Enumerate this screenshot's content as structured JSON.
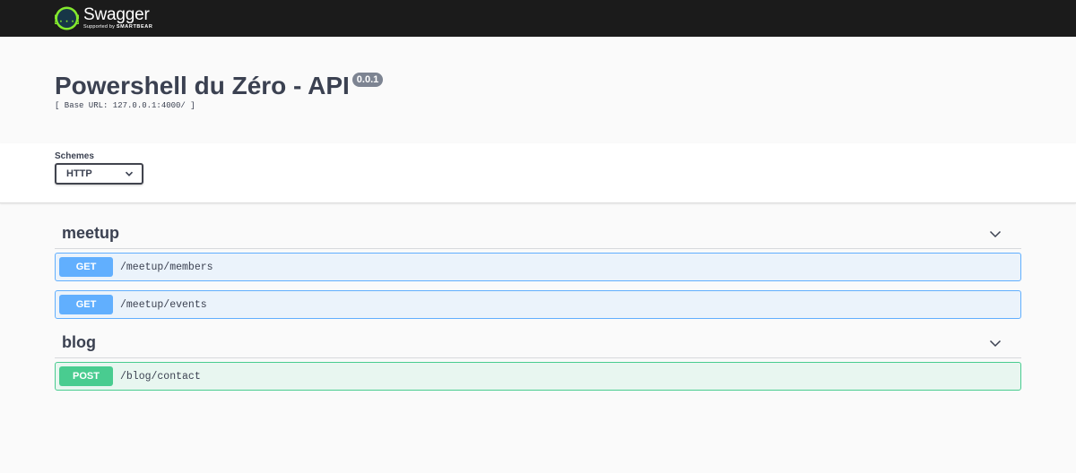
{
  "topbar": {
    "logo_name": "Swagger",
    "logo_tag_prefix": "Supported by",
    "logo_tag_brand": "SMARTBEAR",
    "logo_icon": "swagger-logo-icon",
    "colors": {
      "background": "#1b1b1b",
      "logo_green": "#85ea2d"
    }
  },
  "info": {
    "title": "Powershell du Zéro - API",
    "version": "0.0.1",
    "base_url": "[ Base URL: 127.0.0.1:4000/ ]"
  },
  "schemes": {
    "label": "Schemes",
    "selected": "HTTP"
  },
  "tags": [
    {
      "name": "meetup",
      "operations": [
        {
          "method": "GET",
          "path": "/meetup/members"
        },
        {
          "method": "GET",
          "path": "/meetup/events"
        }
      ]
    },
    {
      "name": "blog",
      "operations": [
        {
          "method": "POST",
          "path": "/blog/contact"
        }
      ]
    }
  ],
  "colors": {
    "get": "#61affe",
    "get_bg": "#ebf3fb",
    "post": "#49cc90",
    "post_bg": "#e8f6f0",
    "text": "#3b4151",
    "version_badge": "#7d8492"
  }
}
